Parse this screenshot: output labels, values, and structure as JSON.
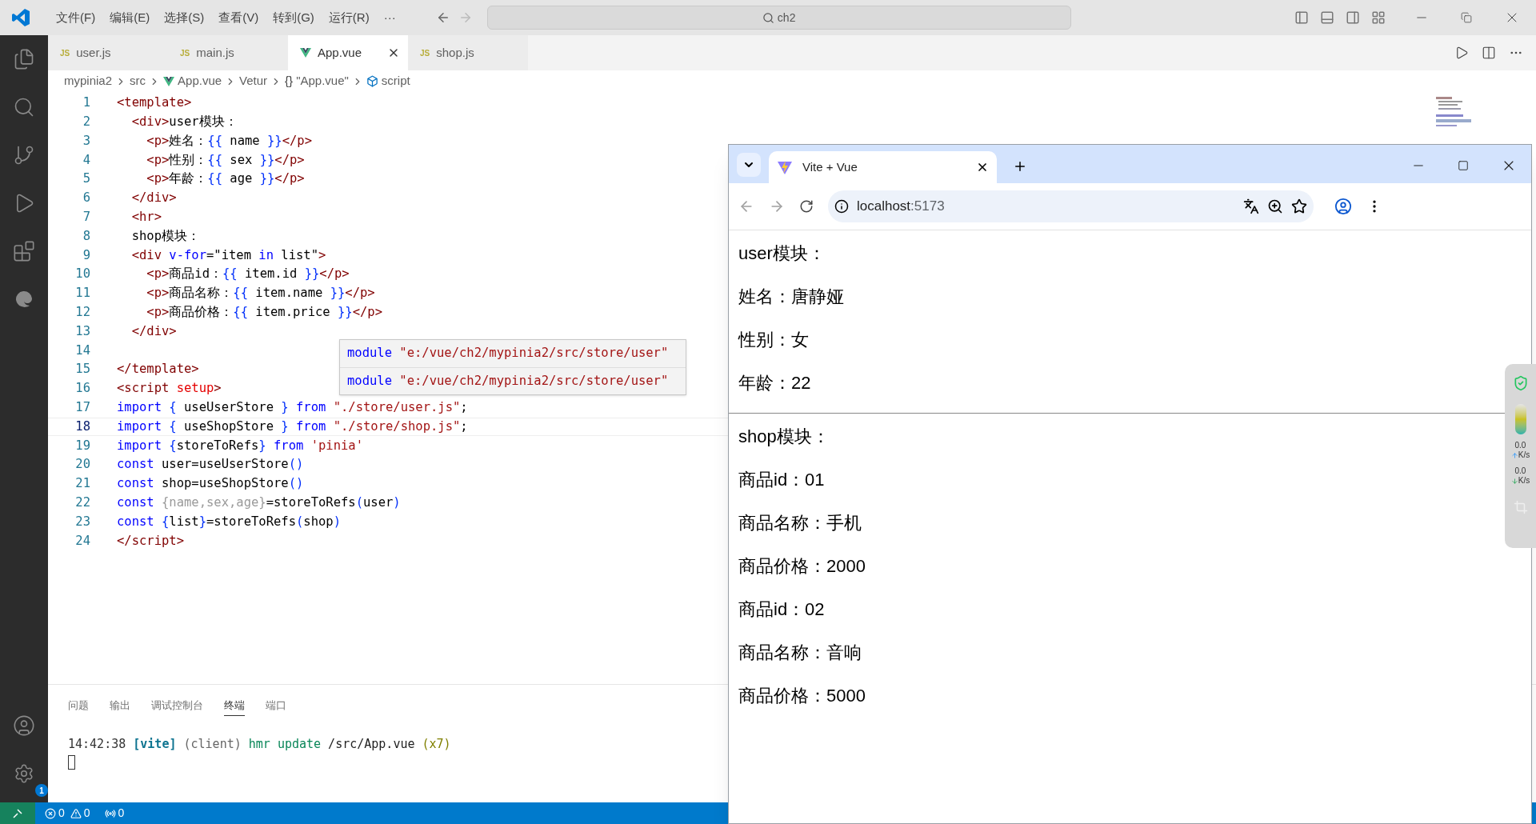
{
  "menu": [
    "文件(F)",
    "编辑(E)",
    "选择(S)",
    "查看(V)",
    "转到(G)",
    "运行(R)",
    "···"
  ],
  "command_center": {
    "value": "ch2"
  },
  "editor_tabs": [
    {
      "kind": "js",
      "badge": "JS",
      "label": "user.js",
      "selected": false
    },
    {
      "kind": "js",
      "badge": "JS",
      "label": "main.js",
      "selected": false
    },
    {
      "kind": "vue",
      "label": "App.vue",
      "selected": true
    },
    {
      "kind": "js",
      "badge": "JS",
      "label": "shop.js",
      "selected": false
    }
  ],
  "breadcrumbs": [
    {
      "kind": "text",
      "label": "mypinia2"
    },
    {
      "kind": "text",
      "label": "src"
    },
    {
      "kind": "vue",
      "label": "App.vue"
    },
    {
      "kind": "text",
      "label": "Vetur"
    },
    {
      "kind": "braces",
      "glyph": "{}",
      "label": "\"App.vue\""
    },
    {
      "kind": "cube",
      "label": "script"
    }
  ],
  "code_lines": [
    {
      "n": "1",
      "current": false,
      "tokens": [
        {
          "kind": "tag",
          "text": "<template>"
        }
      ]
    },
    {
      "n": "2",
      "current": false,
      "tokens": [
        {
          "kind": "tag",
          "text": "  <div>"
        },
        {
          "kind": "text",
          "text": "user模块："
        }
      ]
    },
    {
      "n": "3",
      "current": false,
      "tokens": [
        {
          "kind": "tag",
          "text": "    <p>"
        },
        {
          "kind": "text",
          "text": "姓名："
        },
        {
          "kind": "brace",
          "text": "{{"
        },
        {
          "kind": "text",
          "text": " name "
        },
        {
          "kind": "brace",
          "text": "}}"
        },
        {
          "kind": "tag",
          "text": "</p>"
        }
      ]
    },
    {
      "n": "4",
      "current": false,
      "tokens": [
        {
          "kind": "tag",
          "text": "    <p>"
        },
        {
          "kind": "text",
          "text": "性别："
        },
        {
          "kind": "brace",
          "text": "{{"
        },
        {
          "kind": "text",
          "text": " sex "
        },
        {
          "kind": "brace",
          "text": "}}"
        },
        {
          "kind": "tag",
          "text": "</p>"
        }
      ]
    },
    {
      "n": "5",
      "current": false,
      "tokens": [
        {
          "kind": "tag",
          "text": "    <p>"
        },
        {
          "kind": "text",
          "text": "年龄："
        },
        {
          "kind": "brace",
          "text": "{{"
        },
        {
          "kind": "text",
          "text": " age "
        },
        {
          "kind": "brace",
          "text": "}}"
        },
        {
          "kind": "tag",
          "text": "</p>"
        }
      ]
    },
    {
      "n": "6",
      "current": false,
      "tokens": [
        {
          "kind": "tag",
          "text": "  </div>"
        }
      ]
    },
    {
      "n": "7",
      "current": false,
      "tokens": [
        {
          "kind": "tag",
          "text": "  <hr>"
        }
      ]
    },
    {
      "n": "8",
      "current": false,
      "tokens": [
        {
          "kind": "text",
          "text": "  shop模块："
        }
      ]
    },
    {
      "n": "9",
      "current": false,
      "tokens": [
        {
          "kind": "tag",
          "text": "  <div "
        },
        {
          "kind": "keyword",
          "text": "v-for"
        },
        {
          "kind": "text",
          "text": "=\"item "
        },
        {
          "kind": "keyword",
          "text": "in"
        },
        {
          "kind": "text",
          "text": " list\""
        },
        {
          "kind": "tag",
          "text": ">"
        }
      ]
    },
    {
      "n": "10",
      "current": false,
      "tokens": [
        {
          "kind": "tag",
          "text": "    <p>"
        },
        {
          "kind": "text",
          "text": "商品id："
        },
        {
          "kind": "brace",
          "text": "{{"
        },
        {
          "kind": "text",
          "text": " item.id "
        },
        {
          "kind": "brace",
          "text": "}}"
        },
        {
          "kind": "tag",
          "text": "</p>"
        }
      ]
    },
    {
      "n": "11",
      "current": false,
      "tokens": [
        {
          "kind": "tag",
          "text": "    <p>"
        },
        {
          "kind": "text",
          "text": "商品名称："
        },
        {
          "kind": "brace",
          "text": "{{"
        },
        {
          "kind": "text",
          "text": " item.name "
        },
        {
          "kind": "brace",
          "text": "}}"
        },
        {
          "kind": "tag",
          "text": "</p>"
        }
      ]
    },
    {
      "n": "12",
      "current": false,
      "tokens": [
        {
          "kind": "tag",
          "text": "    <p>"
        },
        {
          "kind": "text",
          "text": "商品价格："
        },
        {
          "kind": "brace",
          "text": "{{"
        },
        {
          "kind": "text",
          "text": " item.price "
        },
        {
          "kind": "brace",
          "text": "}}"
        },
        {
          "kind": "tag",
          "text": "</p>"
        }
      ]
    },
    {
      "n": "13",
      "current": false,
      "tokens": [
        {
          "kind": "tag",
          "text": "  </div>"
        }
      ]
    },
    {
      "n": "14",
      "current": false
    },
    {
      "n": "15",
      "current": false,
      "tokens": [
        {
          "kind": "tag",
          "text": "</template>"
        }
      ]
    },
    {
      "n": "16",
      "current": false,
      "tokens": [
        {
          "kind": "tag",
          "text": "<script "
        },
        {
          "kind": "attr",
          "text": "setup"
        },
        {
          "kind": "tag",
          "text": ">"
        }
      ]
    },
    {
      "n": "17",
      "current": false,
      "tokens": [
        {
          "kind": "keyword",
          "text": "import"
        },
        {
          "kind": "brace",
          "text": " {"
        },
        {
          "kind": "text",
          "text": " useUserStore "
        },
        {
          "kind": "brace",
          "text": "}"
        },
        {
          "kind": "keyword",
          "text": " from"
        },
        {
          "kind": "string",
          "text": " \"./store/user.js\""
        },
        {
          "kind": "text",
          "text": ";"
        }
      ]
    },
    {
      "n": "18",
      "current": true,
      "tokens": [
        {
          "kind": "keyword",
          "text": "import"
        },
        {
          "kind": "brace",
          "text": " {"
        },
        {
          "kind": "text",
          "text": " useShopStore "
        },
        {
          "kind": "brace",
          "text": "}"
        },
        {
          "kind": "keyword",
          "text": " from"
        },
        {
          "kind": "string",
          "text": " \"./store/shop.js\""
        },
        {
          "kind": "text",
          "text": ";"
        }
      ]
    },
    {
      "n": "19",
      "current": false,
      "tokens": [
        {
          "kind": "keyword",
          "text": "import"
        },
        {
          "kind": "brace",
          "text": " {"
        },
        {
          "kind": "text",
          "text": "storeToRefs"
        },
        {
          "kind": "brace",
          "text": "}"
        },
        {
          "kind": "keyword",
          "text": " from"
        },
        {
          "kind": "string",
          "text": " 'pinia'"
        }
      ]
    },
    {
      "n": "20",
      "current": false,
      "tokens": [
        {
          "kind": "keyword",
          "text": "const"
        },
        {
          "kind": "text",
          "text": " user=useUserStore"
        },
        {
          "kind": "brace",
          "text": "()"
        }
      ]
    },
    {
      "n": "21",
      "current": false,
      "tokens": [
        {
          "kind": "keyword",
          "text": "const"
        },
        {
          "kind": "text",
          "text": " shop=useShopStore"
        },
        {
          "kind": "brace",
          "text": "()"
        }
      ]
    },
    {
      "n": "22",
      "current": false,
      "tokens": [
        {
          "kind": "keyword",
          "text": "const"
        },
        {
          "kind": "unused",
          "text": " {name,sex,age}"
        },
        {
          "kind": "text",
          "text": "=storeToRefs"
        },
        {
          "kind": "brace",
          "text": "("
        },
        {
          "kind": "text",
          "text": "user"
        },
        {
          "kind": "brace",
          "text": ")"
        }
      ]
    },
    {
      "n": "23",
      "current": false,
      "tokens": [
        {
          "kind": "keyword",
          "text": "const"
        },
        {
          "kind": "brace",
          "text": " {"
        },
        {
          "kind": "text",
          "text": "list"
        },
        {
          "kind": "brace",
          "text": "}"
        },
        {
          "kind": "text",
          "text": "=storeToRefs"
        },
        {
          "kind": "brace",
          "text": "("
        },
        {
          "kind": "text",
          "text": "shop"
        },
        {
          "kind": "brace",
          "text": ")"
        }
      ]
    },
    {
      "n": "24",
      "current": false,
      "tokens": [
        {
          "kind": "tag",
          "text": "</script>"
        }
      ]
    }
  ],
  "hover": [
    {
      "keyword": "module",
      "text": "\"e:/vue/ch2/mypinia2/src/store/user\""
    },
    {
      "keyword": "module",
      "text": "\"e:/vue/ch2/mypinia2/src/store/user\""
    }
  ],
  "panel_tabs": [
    {
      "label": "问题",
      "selected": false
    },
    {
      "label": "输出",
      "selected": false
    },
    {
      "label": "调试控制台",
      "selected": false
    },
    {
      "label": "终端",
      "selected": true
    },
    {
      "label": "端口",
      "selected": false
    }
  ],
  "terminal": [
    {
      "kind": "time",
      "text": "14:42:38 "
    },
    {
      "kind": "tag",
      "text": "[vite]"
    },
    {
      "kind": "dim",
      "text": " (client) "
    },
    {
      "kind": "ok",
      "text": "hmr update"
    },
    {
      "kind": "plain",
      "text": " /src/App.vue "
    },
    {
      "kind": "count",
      "text": "(x7)"
    }
  ],
  "settings_badge": "1",
  "status": {
    "errors": "0",
    "warnings": "0",
    "ports": "0"
  },
  "browser": {
    "tab_title": "Vite + Vue",
    "url_host": "localhost",
    "url_port": ":5173",
    "content": [
      {
        "kind": "p",
        "text": "user模块："
      },
      {
        "kind": "p",
        "text": "姓名：唐静娅"
      },
      {
        "kind": "p",
        "text": "性别：女"
      },
      {
        "kind": "p",
        "text": "年龄：22"
      },
      {
        "kind": "hr"
      },
      {
        "kind": "p",
        "text": "shop模块："
      },
      {
        "kind": "p",
        "text": "商品id：01"
      },
      {
        "kind": "p",
        "text": "商品名称：手机"
      },
      {
        "kind": "p",
        "text": "商品价格：2000"
      },
      {
        "kind": "p",
        "text": "商品id：02"
      },
      {
        "kind": "p",
        "text": "商品名称：音响"
      },
      {
        "kind": "p",
        "text": "商品价格：5000"
      }
    ]
  },
  "speed_widget": [
    {
      "kind": "up",
      "value": "0.0",
      "unit": "K/s"
    },
    {
      "kind": "down",
      "value": "0.0",
      "unit": "K/s"
    }
  ]
}
